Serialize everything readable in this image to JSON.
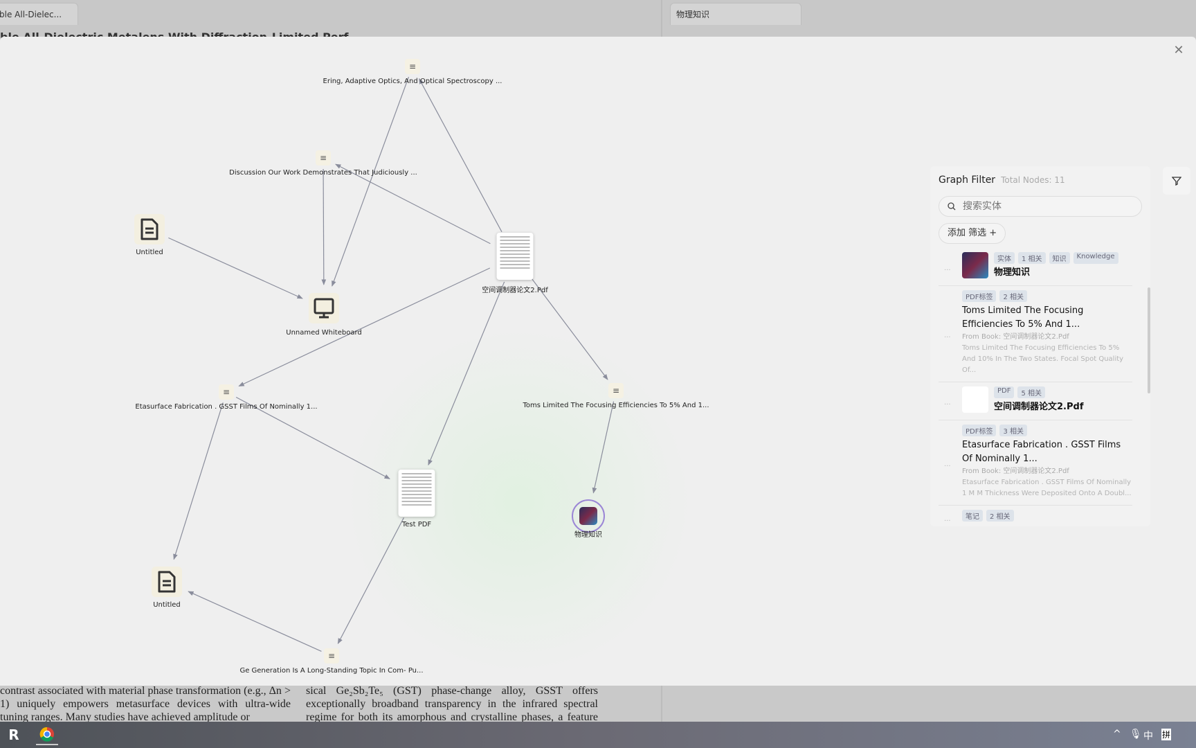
{
  "tabs": [
    {
      "label": "ble All-Dielec..."
    },
    {
      "label": "物理知识"
    }
  ],
  "background_title": "ble All-Dielectric Metalens With Diffraction-Limited Perf...",
  "paper": {
    "col1": "contrast associated with material phase transformation (e.g., Δn > 1) uniquely empowers metasurface devices with ultra-wide tuning ranges. Many studies have achieved amplitude or",
    "col2": "sical Ge₂Sb₂Te₅ (GST) phase-change alloy, GSST offers exceptionally broadband transparency in the infrared spectral regime for both its amorphous and crystalline phases, a feature critical to"
  },
  "graph": {
    "nodes": [
      {
        "id": "ering",
        "type": "text",
        "label": "Ering, Adaptive Optics, And Optical Spectroscopy ..."
      },
      {
        "id": "discussion",
        "type": "text",
        "label": "Discussion Our Work Demonstrates That Judiciously ..."
      },
      {
        "id": "untitled1",
        "type": "note",
        "label": "Untitled"
      },
      {
        "id": "whiteboard",
        "type": "whiteboard",
        "label": "Unnamed Whiteboard"
      },
      {
        "id": "pdf2",
        "type": "pdf",
        "label": "空间调制器论文2.Pdf"
      },
      {
        "id": "etasurface",
        "type": "text",
        "label": "Etasurface Fabrication . GSST Films Of Nominally 1..."
      },
      {
        "id": "toms",
        "type": "text",
        "label": "Toms Limited The Focusing Efficiencies To 5% And 1..."
      },
      {
        "id": "testpdf",
        "type": "pdf",
        "label": "Test PDF"
      },
      {
        "id": "wuli",
        "type": "entity",
        "label": "物理知识"
      },
      {
        "id": "untitled2",
        "type": "note",
        "label": "Untitled"
      },
      {
        "id": "ge",
        "type": "text",
        "label": "Ge Generation Is A Long-Standing Topic In Com- Pu..."
      }
    ],
    "edges": [
      [
        "untitled1",
        "whiteboard"
      ],
      [
        "discussion",
        "whiteboard"
      ],
      [
        "ering",
        "whiteboard"
      ],
      [
        "pdf2",
        "discussion"
      ],
      [
        "pdf2",
        "ering"
      ],
      [
        "pdf2",
        "etasurface"
      ],
      [
        "pdf2",
        "testpdf"
      ],
      [
        "pdf2",
        "toms"
      ],
      [
        "toms",
        "wuli"
      ],
      [
        "etasurface",
        "testpdf"
      ],
      [
        "etasurface",
        "untitled2"
      ],
      [
        "testpdf",
        "ge"
      ],
      [
        "ge",
        "untitled2"
      ]
    ],
    "edge_color": "#8a8d9c"
  },
  "filter": {
    "title": "Graph Filter",
    "total": "Total Nodes: 11",
    "search_placeholder": "搜索实体",
    "add_filter": "添加 筛选 +",
    "items": [
      {
        "tags": [
          "实体",
          "1 相关",
          "知识",
          "Knowledge"
        ],
        "title": "物理知识"
      },
      {
        "tags": [
          "PDF标签",
          "2 相关"
        ],
        "title": "Toms Limited The Focusing Efficiencies To 5% And 1...",
        "from": "From Book: 空间调制器论文2.Pdf",
        "desc": "Toms Limited The Focusing Efficiencies To 5% And 10% In The Two States. Focal Spot Quality Of..."
      },
      {
        "tags": [
          "PDF",
          "5 相关"
        ],
        "title": "空间调制器论文2.Pdf"
      },
      {
        "tags": [
          "PDF标签",
          "3 相关"
        ],
        "title": "Etasurface Fabrication . GSST Films Of Nominally 1...",
        "from": "From Book: 空间调制器论文2.Pdf",
        "desc": "Etasurface Fabrication . GSST Films Of Nominally 1 M M Thickness Were Deposited Onto A Doubl..."
      },
      {
        "tags": [
          "笔记",
          "2 相关"
        ]
      }
    ]
  },
  "tray": {
    "ime": "中",
    "ime2": "拼"
  }
}
